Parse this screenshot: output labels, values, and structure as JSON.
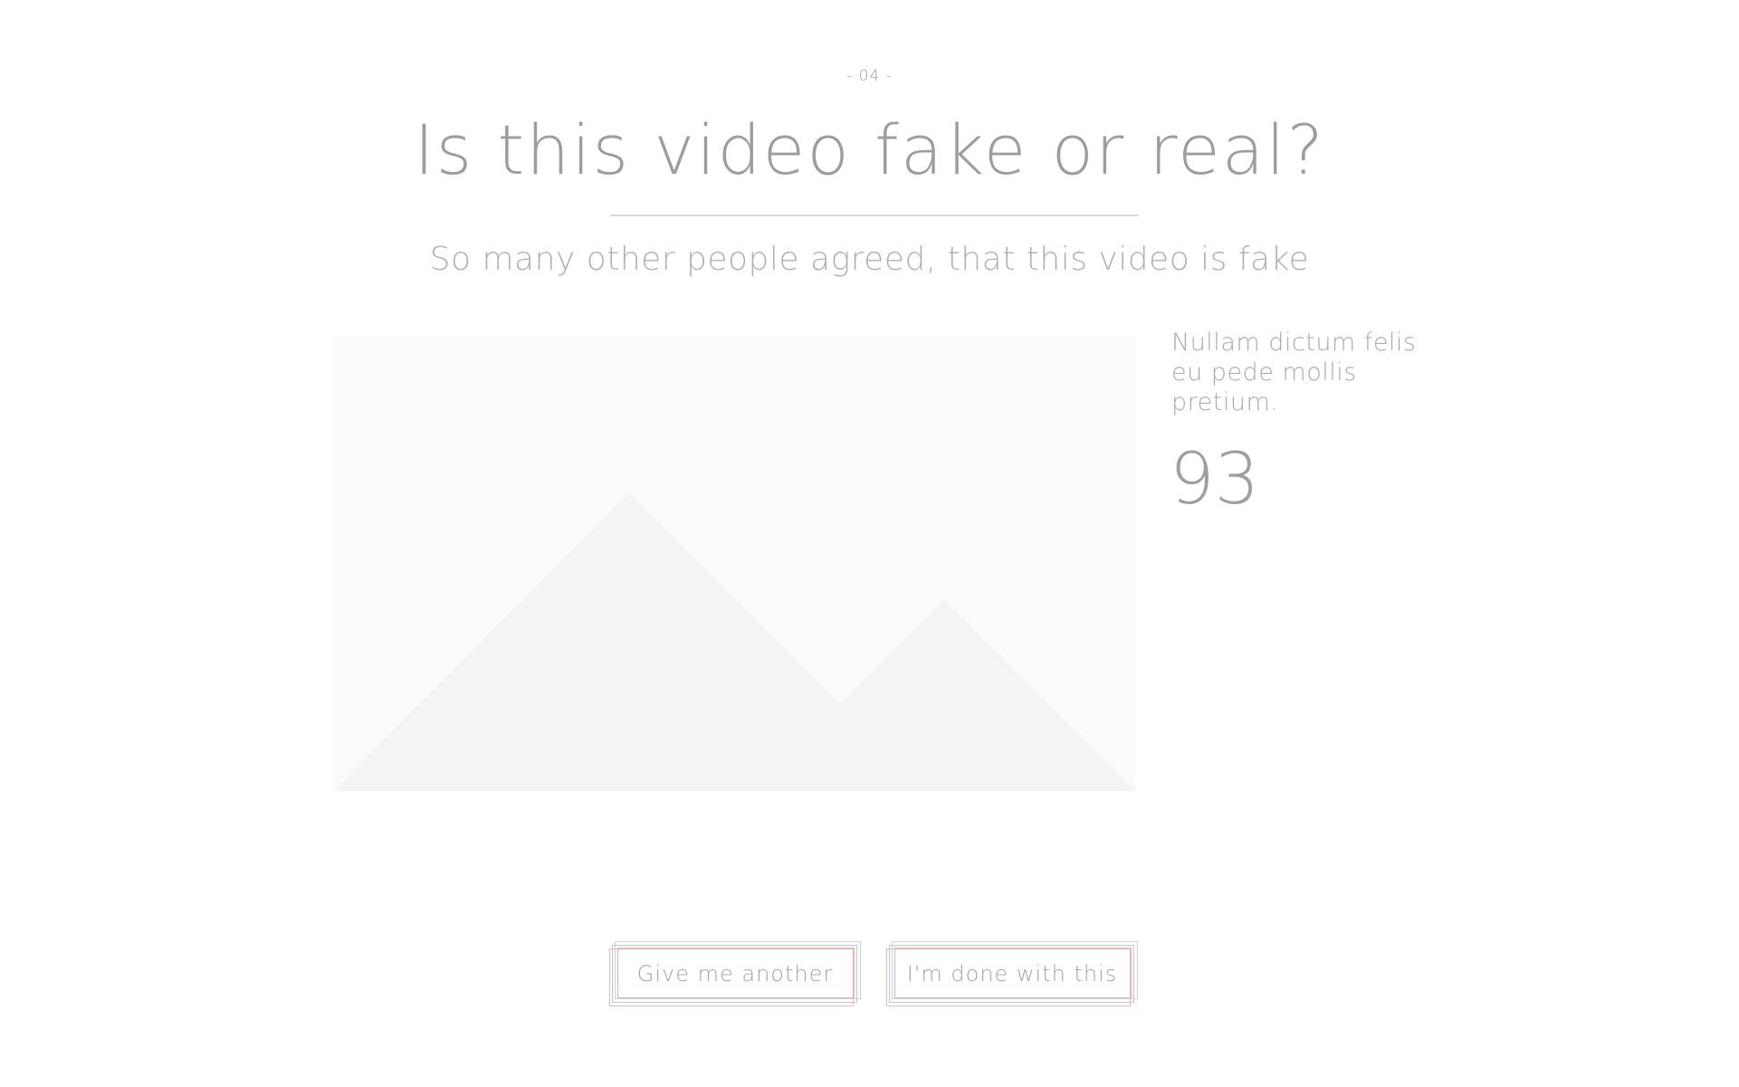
{
  "header": {
    "step": "- 04 -",
    "title": "Is this video fake or real?",
    "subtitle": "So many other people agreed, that this video is fake"
  },
  "media": {
    "placeholder_icon": "image-placeholder-icon"
  },
  "stats": {
    "description": "Nullam dictum felis eu pede mollis pretium.",
    "value": "93"
  },
  "actions": {
    "another_label": "Give me another",
    "done_label": "I'm done with this"
  },
  "colors": {
    "text_primary": "#9d9d9d",
    "divider": "#d7d7d7",
    "media_bg": "#fbfbfb",
    "mountain": "#f4f4f4",
    "button_frame_blue": "#b9c7df",
    "button_frame_red": "#f2b9b3"
  }
}
